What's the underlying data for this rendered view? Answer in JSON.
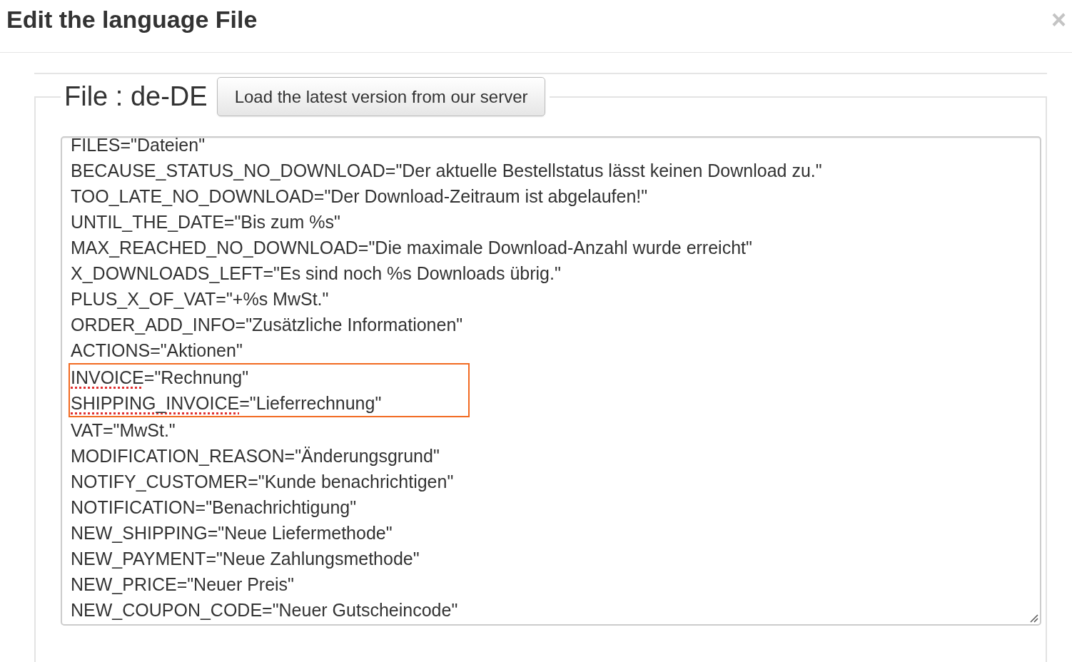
{
  "dialog": {
    "title": "Edit the language File",
    "close": "×"
  },
  "file": {
    "legend": "File : de-DE",
    "load_button": "Load the latest version from our server"
  },
  "lines": [
    {
      "key": "FILES",
      "rest": "=\"Dateien\"",
      "spell_error": false,
      "highlighted": false
    },
    {
      "key": "BECAUSE_STATUS_NO_DOWNLOAD",
      "rest": "=\"Der aktuelle Bestellstatus lässt keinen Download zu.\"",
      "spell_error": false,
      "highlighted": false
    },
    {
      "key": "TOO_LATE_NO_DOWNLOAD",
      "rest": "=\"Der Download-Zeitraum ist abgelaufen!\"",
      "spell_error": false,
      "highlighted": false
    },
    {
      "key": "UNTIL_THE_DATE",
      "rest": "=\"Bis zum %s\"",
      "spell_error": false,
      "highlighted": false
    },
    {
      "key": "MAX_REACHED_NO_DOWNLOAD",
      "rest": "=\"Die maximale Download-Anzahl wurde erreicht\"",
      "spell_error": false,
      "highlighted": false
    },
    {
      "key": "X_DOWNLOADS_LEFT",
      "rest": "=\"Es sind noch %s Downloads übrig.\"",
      "spell_error": false,
      "highlighted": false
    },
    {
      "key": "PLUS_X_OF_VAT",
      "rest": "=\"+%s MwSt.\"",
      "spell_error": false,
      "highlighted": false
    },
    {
      "key": "ORDER_ADD_INFO",
      "rest": "=\"Zusätzliche Informationen\"",
      "spell_error": false,
      "highlighted": false
    },
    {
      "key": "ACTIONS",
      "rest": "=\"Aktionen\"",
      "spell_error": false,
      "highlighted": false
    },
    {
      "key": "INVOICE",
      "rest": "=\"Rechnung\"",
      "spell_error": true,
      "highlighted": true
    },
    {
      "key": "SHIPPING_INVOICE",
      "rest": "=\"Lieferrechnung\"",
      "spell_error": true,
      "highlighted": true
    },
    {
      "key": "VAT",
      "rest": "=\"MwSt.\"",
      "spell_error": false,
      "highlighted": false
    },
    {
      "key": "MODIFICATION_REASON",
      "rest": "=\"Änderungsgrund\"",
      "spell_error": false,
      "highlighted": false
    },
    {
      "key": "NOTIFY_CUSTOMER",
      "rest": "=\"Kunde benachrichtigen\"",
      "spell_error": false,
      "highlighted": false
    },
    {
      "key": "NOTIFICATION",
      "rest": "=\"Benachrichtigung\"",
      "spell_error": false,
      "highlighted": false
    },
    {
      "key": "NEW_SHIPPING",
      "rest": "=\"Neue Liefermethode\"",
      "spell_error": false,
      "highlighted": false
    },
    {
      "key": "NEW_PAYMENT",
      "rest": "=\"Neue Zahlungsmethode\"",
      "spell_error": false,
      "highlighted": false
    },
    {
      "key": "NEW_PRICE",
      "rest": "=\"Neuer Preis\"",
      "spell_error": false,
      "highlighted": false
    },
    {
      "key": "NEW_COUPON_CODE",
      "rest": "=\"Neuer Gutscheincode\"",
      "spell_error": false,
      "highlighted": false
    }
  ]
}
